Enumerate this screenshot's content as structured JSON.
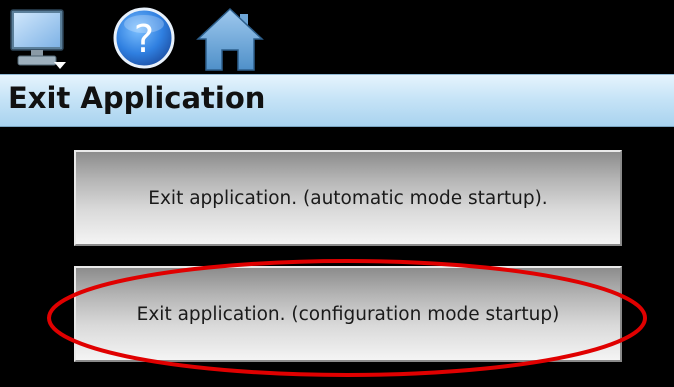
{
  "toolbar": {
    "icons": [
      {
        "name": "monitor-icon",
        "label": ""
      },
      {
        "name": "help-icon",
        "label": "?"
      },
      {
        "name": "home-icon",
        "label": ""
      }
    ]
  },
  "title": "Exit Application",
  "buttons": {
    "auto_label": "Exit application. (automatic mode startup).",
    "config_label": "Exit application. (configuration mode startup)"
  },
  "colors": {
    "background": "#000000",
    "title_bar": "#c7e4f7",
    "annotation": "#e00000"
  }
}
